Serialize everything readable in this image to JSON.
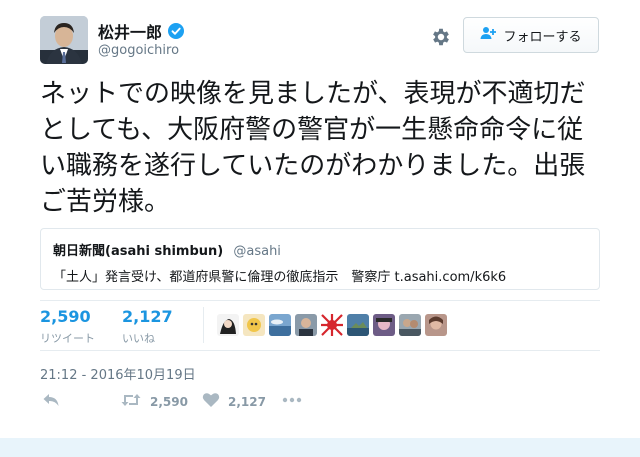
{
  "user": {
    "display_name": "松井一郎",
    "handle": "@gogoichiro"
  },
  "follow_button": {
    "label": "フォローする"
  },
  "tweet": {
    "text": "ネットでの映像を見ましたが、表現が不適切だとしても、大阪府警の警官が一生懸命命令に従い職務を遂行していたのがわかりました。出張ご苦労様。"
  },
  "quote": {
    "name": "朝日新聞(asahi shimbun)",
    "handle": "@asahi",
    "text": "「土人」発言受け、都道府県警に倫理の徹底指示　警察庁",
    "link": "t.asahi.com/k6k6"
  },
  "stats": {
    "retweets": {
      "value": "2,590",
      "label": "リツイート"
    },
    "likes": {
      "value": "2,127",
      "label": "いいね"
    }
  },
  "timestamp": "21:12 - 2016年10月19日",
  "actions": {
    "retweet_count": "2,590",
    "like_count": "2,127"
  },
  "colors": {
    "link_blue": "#1b95e0",
    "verified_blue": "#1da1f2",
    "muted_gray": "#657786",
    "action_gray": "#aab8c2"
  },
  "icons": [
    "verified-badge-icon",
    "gear-icon",
    "follow-person-icon",
    "reply-icon",
    "retweet-icon",
    "heart-icon",
    "more-icon"
  ]
}
